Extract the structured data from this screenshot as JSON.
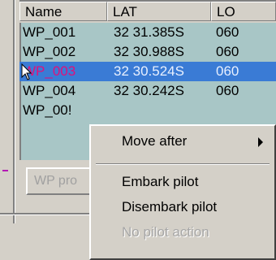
{
  "grid": {
    "columns": [
      "Name",
      "LAT",
      "LO"
    ],
    "rows": [
      {
        "name": "WP_001",
        "lat": "32 31.385S",
        "lon": "060"
      },
      {
        "name": "WP_002",
        "lat": "32 30.988S",
        "lon": "060"
      },
      {
        "name": "WP_003",
        "lat": "32 30.524S",
        "lon": "060",
        "selected": true
      },
      {
        "name": "WP_004",
        "lat": "32 30.242S",
        "lon": "060"
      },
      {
        "name": "WP_00!",
        "lat": "",
        "lon": ""
      }
    ]
  },
  "button": {
    "label": "WP pro"
  },
  "context_menu": {
    "items": [
      {
        "label": "Move after",
        "submenu": true
      },
      {
        "label": "Embark pilot"
      },
      {
        "label": "Disembark pilot"
      },
      {
        "label": "No pilot action",
        "disabled": true
      }
    ]
  },
  "colors": {
    "selection": "#3a7bd5",
    "selected_name_text": "#e0117a",
    "grid_background": "#a8c6c6"
  }
}
